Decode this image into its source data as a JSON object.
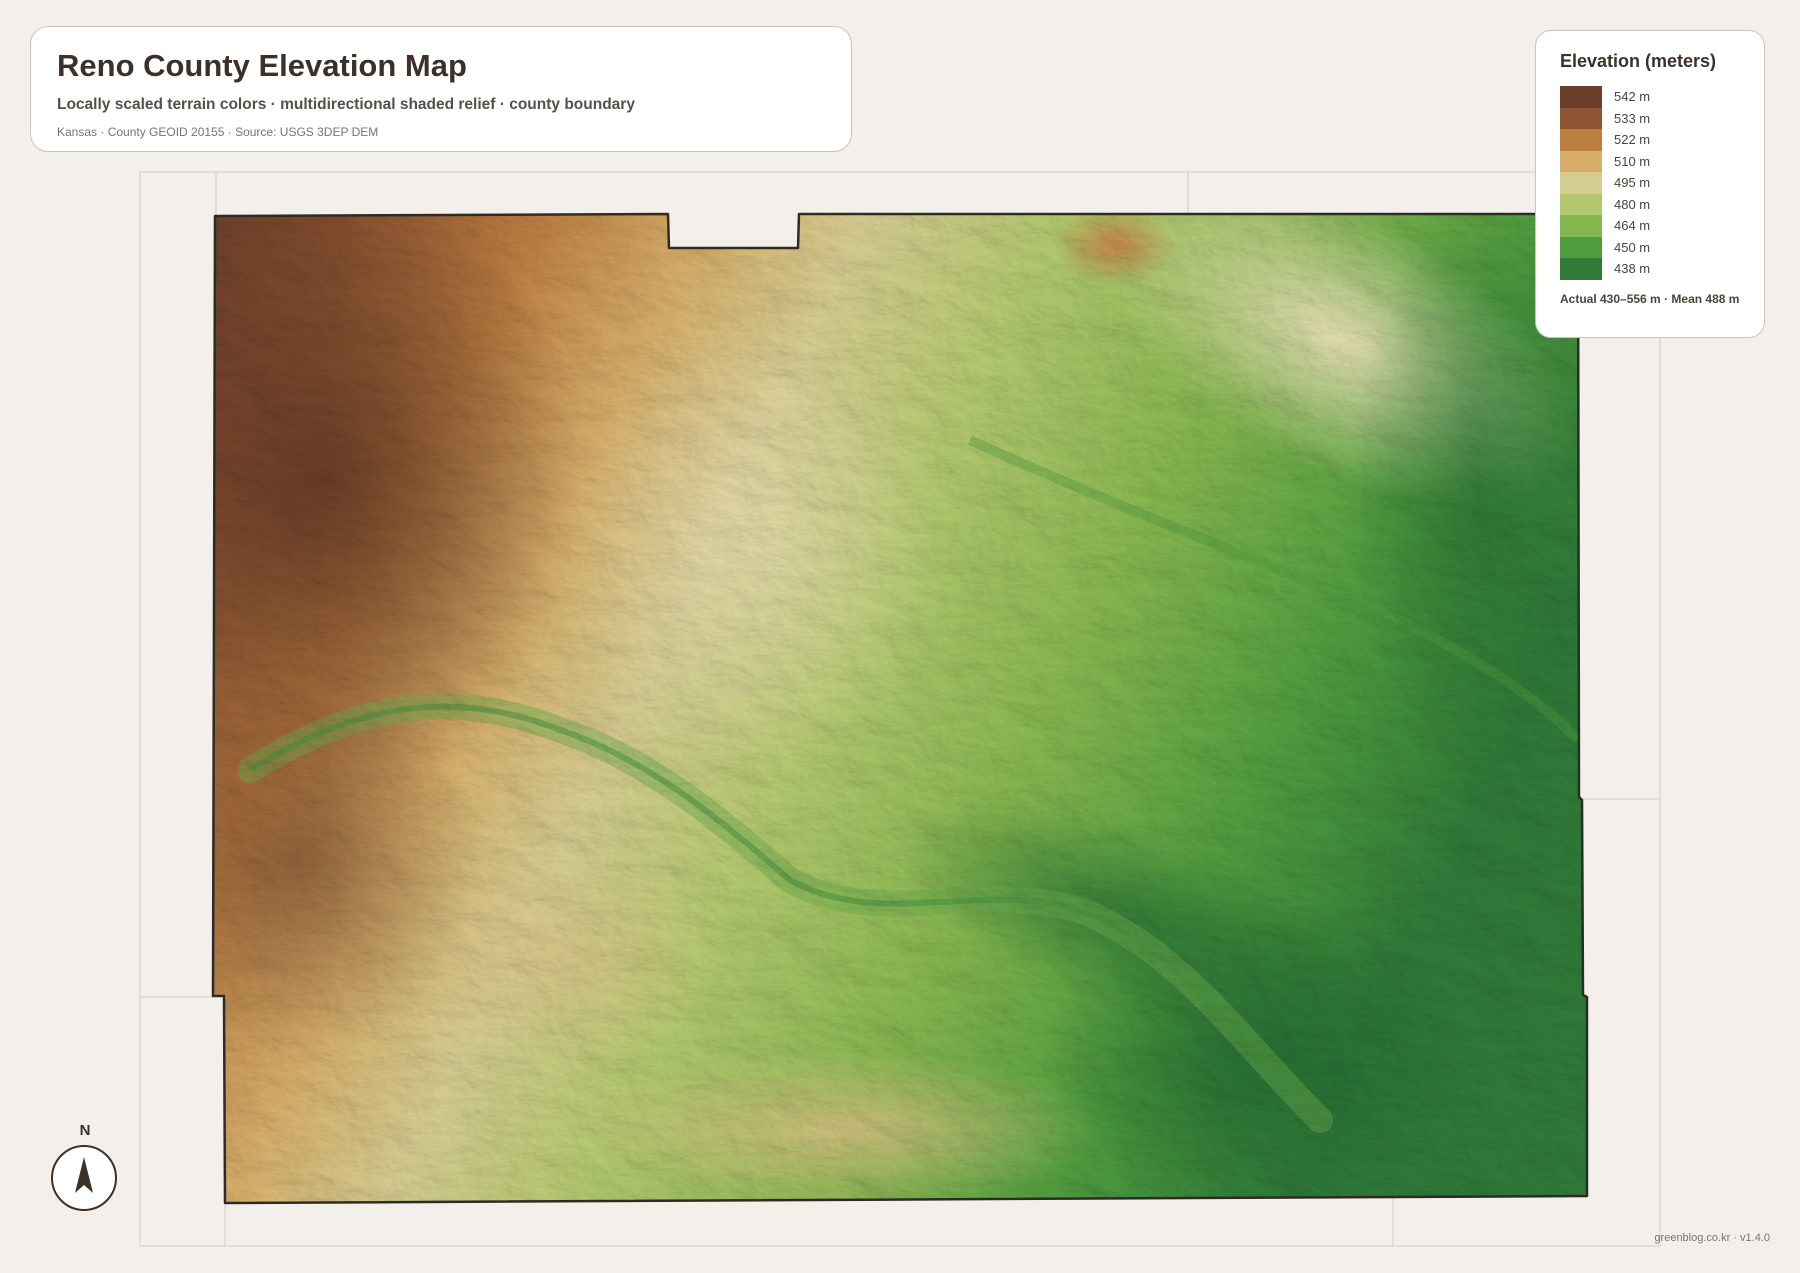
{
  "header": {
    "title": "Reno County Elevation Map",
    "subtitle": "Locally scaled terrain colors · multidirectional shaded relief · county boundary",
    "source": "Kansas · County GEOID 20155 · Source: USGS 3DEP DEM"
  },
  "legend": {
    "title": "Elevation (meters)",
    "items": [
      {
        "label": "542 m",
        "color": "#6b3f2a"
      },
      {
        "label": "533 m",
        "color": "#8f5431"
      },
      {
        "label": "522 m",
        "color": "#bd7e41"
      },
      {
        "label": "510 m",
        "color": "#d6ae6a"
      },
      {
        "label": "495 m",
        "color": "#d5cc90"
      },
      {
        "label": "480 m",
        "color": "#b3c86e"
      },
      {
        "label": "464 m",
        "color": "#86b64e"
      },
      {
        "label": "450 m",
        "color": "#4f9c3e"
      },
      {
        "label": "438 m",
        "color": "#2f7a38"
      }
    ],
    "note": "Actual 430–556 m · Mean 488 m"
  },
  "north_arrow": {
    "letter": "N"
  },
  "footer": {
    "credit": "greenblog.co.kr · v1.4.0"
  },
  "colors": {
    "boundary": "#2e2a26",
    "background": "#f3f0eb",
    "neighbor_lines": "#d8d3cb"
  }
}
